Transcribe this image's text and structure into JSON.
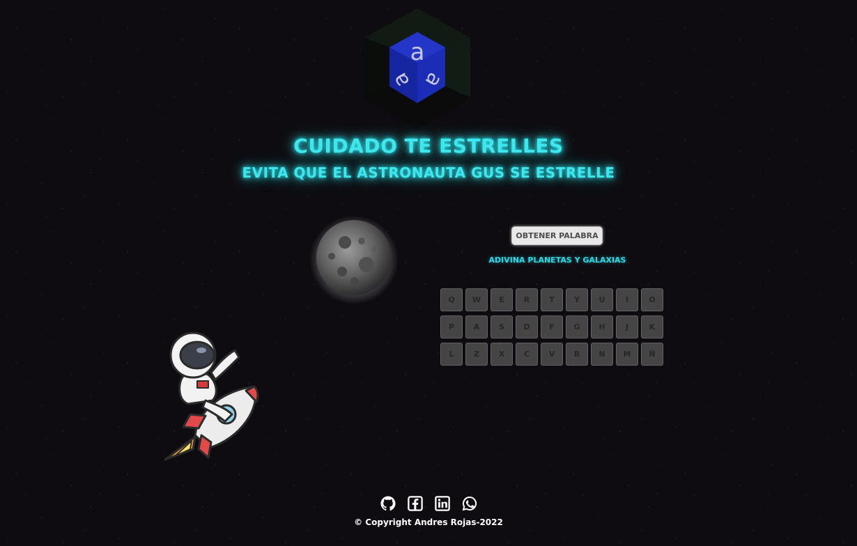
{
  "header": {
    "title": "CUIDADO TE ESTRELLES",
    "subtitle": "EVITA QUE EL ASTRONAUTA GUS SE ESTRELLE"
  },
  "game": {
    "get_word_label": "OBTENER PALABRA",
    "hint": "ADIVINA PLANETAS Y GALAXIAS",
    "keyboard": {
      "row1": [
        "Q",
        "W",
        "E",
        "R",
        "T",
        "Y",
        "U",
        "I",
        "O"
      ],
      "row2": [
        "P",
        "A",
        "S",
        "D",
        "F",
        "G",
        "H",
        "J",
        "K"
      ],
      "row3": [
        "L",
        "Z",
        "X",
        "C",
        "V",
        "B",
        "N",
        "M",
        "Ñ"
      ]
    }
  },
  "footer": {
    "social_icons": [
      "github-icon",
      "facebook-icon",
      "linkedin-icon",
      "whatsapp-icon"
    ],
    "copyright": "© Copyright Andres Rojas-2022"
  },
  "colors": {
    "background": "#0e0c10",
    "title_glow": "#3fe7ec",
    "hint": "#2dd7e3",
    "key_bg": "#5c5c5c"
  }
}
